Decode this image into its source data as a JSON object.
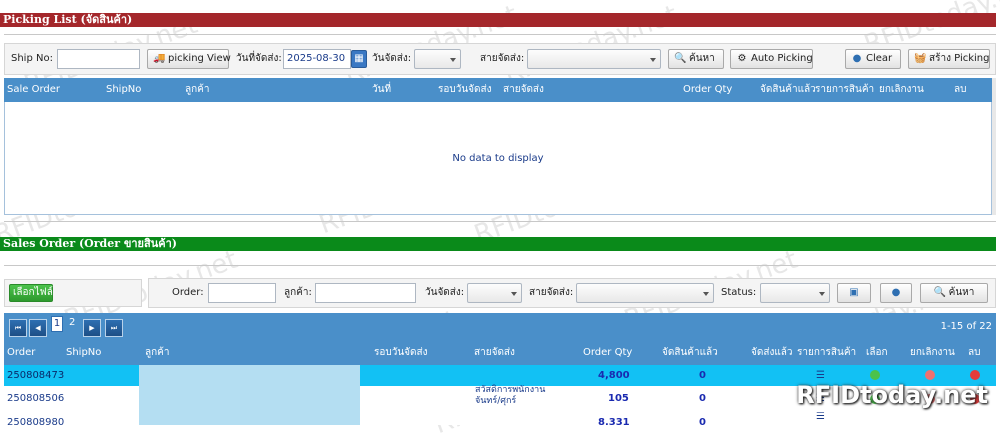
{
  "picking": {
    "title": "Picking List (จัดสินค้า)",
    "ship_no_label": "Ship No:",
    "ship_no_value": "",
    "picking_view_label": "picking View",
    "date_label": "วันที่จัดส่ง:",
    "date_value": "2025-08-30",
    "round_label": "วันจัดส่ง:",
    "route_label": "สายจัดส่ง:",
    "search_label": "ค้นหา",
    "auto_picking_label": "Auto Picking",
    "clear_label": "Clear",
    "create_picking_label": "สร้าง Picking",
    "columns": [
      "Sale Order",
      "ShipNo",
      "ลูกค้า",
      "วันที่",
      "รอบวันจัดส่ง",
      "สายจัดส่ง",
      "Order Qty",
      "จัดสินค้าแล้ว",
      "รายการสินค้า",
      "ยกเลิกงาน",
      "ลบ"
    ],
    "empty_text": "No data to display"
  },
  "sales": {
    "title": "Sales Order (Order ขายสินค้า)",
    "select_all_label": "เลือกไฟล์",
    "order_label": "Order:",
    "customer_label": "ลูกค้า:",
    "round_label": "วันจัดส่ง:",
    "route_label": "สายจัดส่ง:",
    "status_label": "Status:",
    "search_label": "ค้นหา",
    "pages": [
      "1",
      "2"
    ],
    "page_info": "1-15 of 22",
    "columns": [
      "Order",
      "ShipNo",
      "ลูกค้า",
      "รอบวันจัดส่ง",
      "สายจัดส่ง",
      "Order Qty",
      "จัดสินค้าแล้ว",
      "จัดส่งแล้ว",
      "รายการสินค้า",
      "เลือก",
      "ยกเลิกงาน",
      "ลบ"
    ],
    "rows": [
      {
        "order": "250808473",
        "route": "",
        "qty": "4,800",
        "picked": "0"
      },
      {
        "order": "250808506",
        "route": "สวัสดิการพนักงาน จันทร์/ศุกร์",
        "route1": "สวัสดิการพนักงาน",
        "route2": "จันทร์/ศุกร์",
        "qty": "105",
        "picked": "0"
      },
      {
        "order": "250808980",
        "route": "",
        "qty": "8,331",
        "picked": "0"
      }
    ]
  },
  "watermark_text": "RFIDtoday.net",
  "brand_text": "RFIDtoday.net",
  "colors": {
    "red_bar": "#a4272b",
    "green_bar": "#0a8a1a",
    "grid_header": "#4a8fc9",
    "selected_row": "#12c1f4"
  }
}
